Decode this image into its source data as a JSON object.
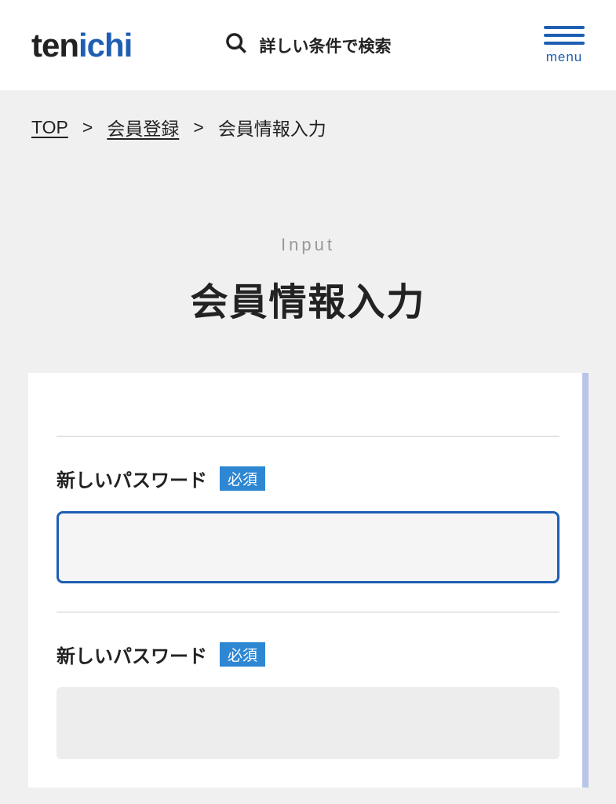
{
  "header": {
    "logo_part1": "ten",
    "logo_part2": "ichi",
    "search_text": "詳しい条件で検索",
    "menu_label": "menu"
  },
  "breadcrumb": {
    "items": [
      {
        "label": "TOP",
        "link": true
      },
      {
        "label": "会員登録",
        "link": true
      },
      {
        "label": "会員情報入力",
        "link": false
      }
    ],
    "separator": ">"
  },
  "page": {
    "subtitle": "Input",
    "title": "会員情報入力"
  },
  "form": {
    "fields": [
      {
        "label": "新しいパスワード",
        "required_text": "必須",
        "active": true
      },
      {
        "label": "新しいパスワード",
        "required_text": "必須",
        "active": false
      }
    ]
  }
}
